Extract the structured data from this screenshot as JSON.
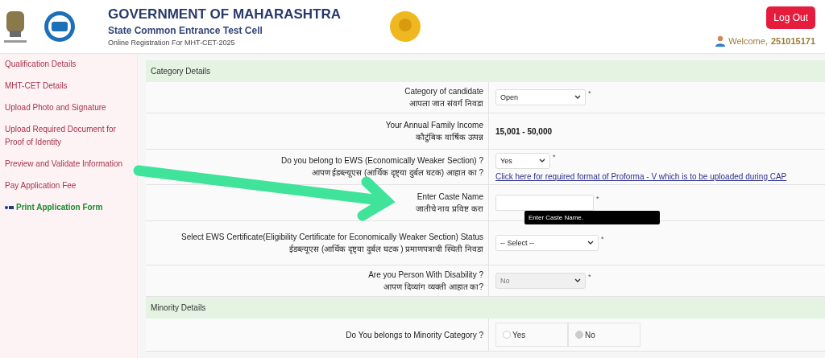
{
  "header": {
    "title": "GOVERNMENT OF MAHARASHTRA",
    "subtitle": "State Common Entrance Test Cell",
    "tagline": "Online Registration For MHT-CET-2025",
    "logout": "Log Out",
    "welcome": "Welcome,",
    "user_id": "251015171"
  },
  "sidebar": {
    "items": [
      {
        "label": "Qualification Details",
        "kind": "link"
      },
      {
        "label": "MHT-CET Details",
        "kind": "link"
      },
      {
        "label": "Upload Photo and Signature",
        "kind": "link"
      },
      {
        "label": "Upload Required Document for Proof of Identity",
        "kind": "link"
      },
      {
        "label": "Preview and Validate Information",
        "kind": "link"
      },
      {
        "label": "Pay Application Fee",
        "kind": "link"
      },
      {
        "label": "Print Application Form",
        "kind": "print"
      }
    ]
  },
  "sections": [
    {
      "title": "Category Details",
      "rows": [
        {
          "kind": "select",
          "label": "Category of candidate",
          "label_mr": "आपला जात संवर्ग निवडा",
          "value": "Open",
          "mark": "*",
          "disabled": false
        },
        {
          "kind": "text",
          "label": "Your Annual Family Income",
          "label_mr": "कौटुंबिक वार्षिक उत्पन्न",
          "value": "15,001 - 50,000"
        },
        {
          "kind": "select",
          "label": "Do you belong to EWS (Economically Weaker Section) ?",
          "label_mr": "आपण ईडब्ल्यूएस (आर्थिक दृष्ट्या दुर्बल घटक) आहात का ?",
          "value": "Yes",
          "mark": "*",
          "disabled": false,
          "link": "Click here for required format of Proforma - V which is to be uploaded during CAP"
        },
        {
          "kind": "input",
          "label": "Enter Caste Name",
          "label_mr": "जातीचे नाव प्रविष्ट करा",
          "mark": "*",
          "tooltip": "Enter Caste Name."
        },
        {
          "kind": "select",
          "label": "Select EWS Certificate(Eligibility Certificate for Economically Weaker Section) Status",
          "label_mr": "ईडब्ल्यूएस (आर्थिक दृष्ट्या दुर्बल घटक ) प्रमाणपत्राची स्थिती निवडा",
          "value": "-- Select --",
          "mark": "*",
          "disabled": false,
          "wide": true
        },
        {
          "kind": "select",
          "label": "Are you Person With Disability ?",
          "label_mr": "आपण दिव्यांग व्यक्ती आहात का?",
          "value": "No",
          "mark": "*",
          "disabled": true
        }
      ]
    },
    {
      "title": "Minority Details",
      "rows": [
        {
          "kind": "radio",
          "label": "Do You belongs to Minority Category ?",
          "options": [
            {
              "label": "Yes",
              "selected": false
            },
            {
              "label": "No",
              "selected": true
            }
          ]
        }
      ]
    }
  ]
}
